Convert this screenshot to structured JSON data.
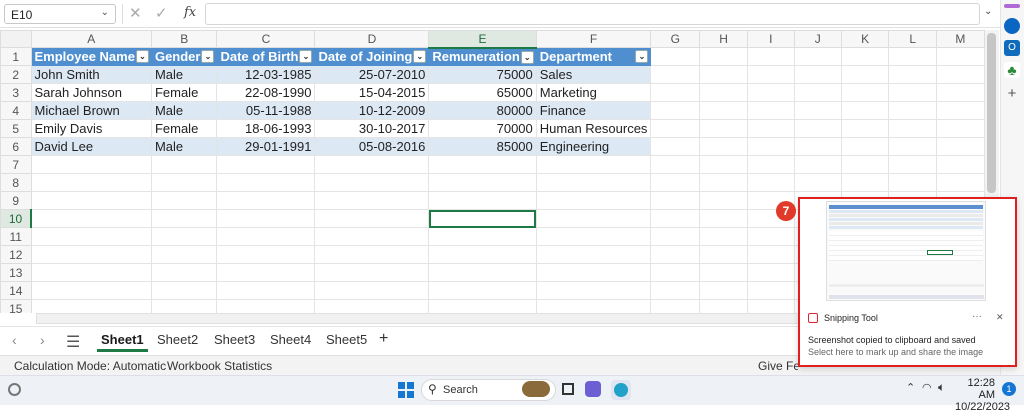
{
  "formula_bar": {
    "name_box": "E10",
    "function_symbol": "fx"
  },
  "columns": [
    "A",
    "B",
    "C",
    "D",
    "E",
    "F",
    "G",
    "H",
    "I",
    "J",
    "K",
    "L",
    "M"
  ],
  "rows": [
    "1",
    "2",
    "3",
    "4",
    "5",
    "6",
    "7",
    "8",
    "9",
    "10",
    "11",
    "12",
    "13",
    "14",
    "15"
  ],
  "table": {
    "headers": [
      "Employee Name",
      "Gender",
      "Date of Birth",
      "Date of Joining",
      "Remuneration",
      "Department"
    ],
    "data": [
      [
        "John Smith",
        "Male",
        "12-03-1985",
        "25-07-2010",
        "75000",
        "Sales"
      ],
      [
        "Sarah Johnson",
        "Female",
        "22-08-1990",
        "15-04-2015",
        "65000",
        "Marketing"
      ],
      [
        "Michael Brown",
        "Male",
        "05-11-1988",
        "10-12-2009",
        "80000",
        "Finance"
      ],
      [
        "Emily Davis",
        "Female",
        "18-06-1993",
        "30-10-2017",
        "70000",
        "Human Resources"
      ],
      [
        "David Lee",
        "Male",
        "29-01-1991",
        "05-08-2016",
        "85000",
        "Engineering"
      ]
    ]
  },
  "sheets": [
    "Sheet1",
    "Sheet2",
    "Sheet3",
    "Sheet4",
    "Sheet5"
  ],
  "active_sheet": "Sheet1",
  "add_sheet": "+",
  "status_bar": {
    "calc_mode": "Calculation Mode: Automatic",
    "workbook_stats": "Workbook Statistics",
    "feedback": "Give Feedback to Microsoft"
  },
  "toast": {
    "badge": "7",
    "app_name": "Snipping Tool",
    "more": "···",
    "close": "✕",
    "title": "Screenshot copied to clipboard and saved",
    "subtitle": "Select here to mark up and share the image"
  },
  "taskbar": {
    "search_label": "Search",
    "time": "12:28 AM",
    "date": "10/22/2023",
    "notif_count": "1"
  },
  "colors": {
    "accent_green": "#1e7a45",
    "table_header": "#4f8fd0",
    "table_band": "#dde8f5",
    "toast_border": "#e02020"
  }
}
